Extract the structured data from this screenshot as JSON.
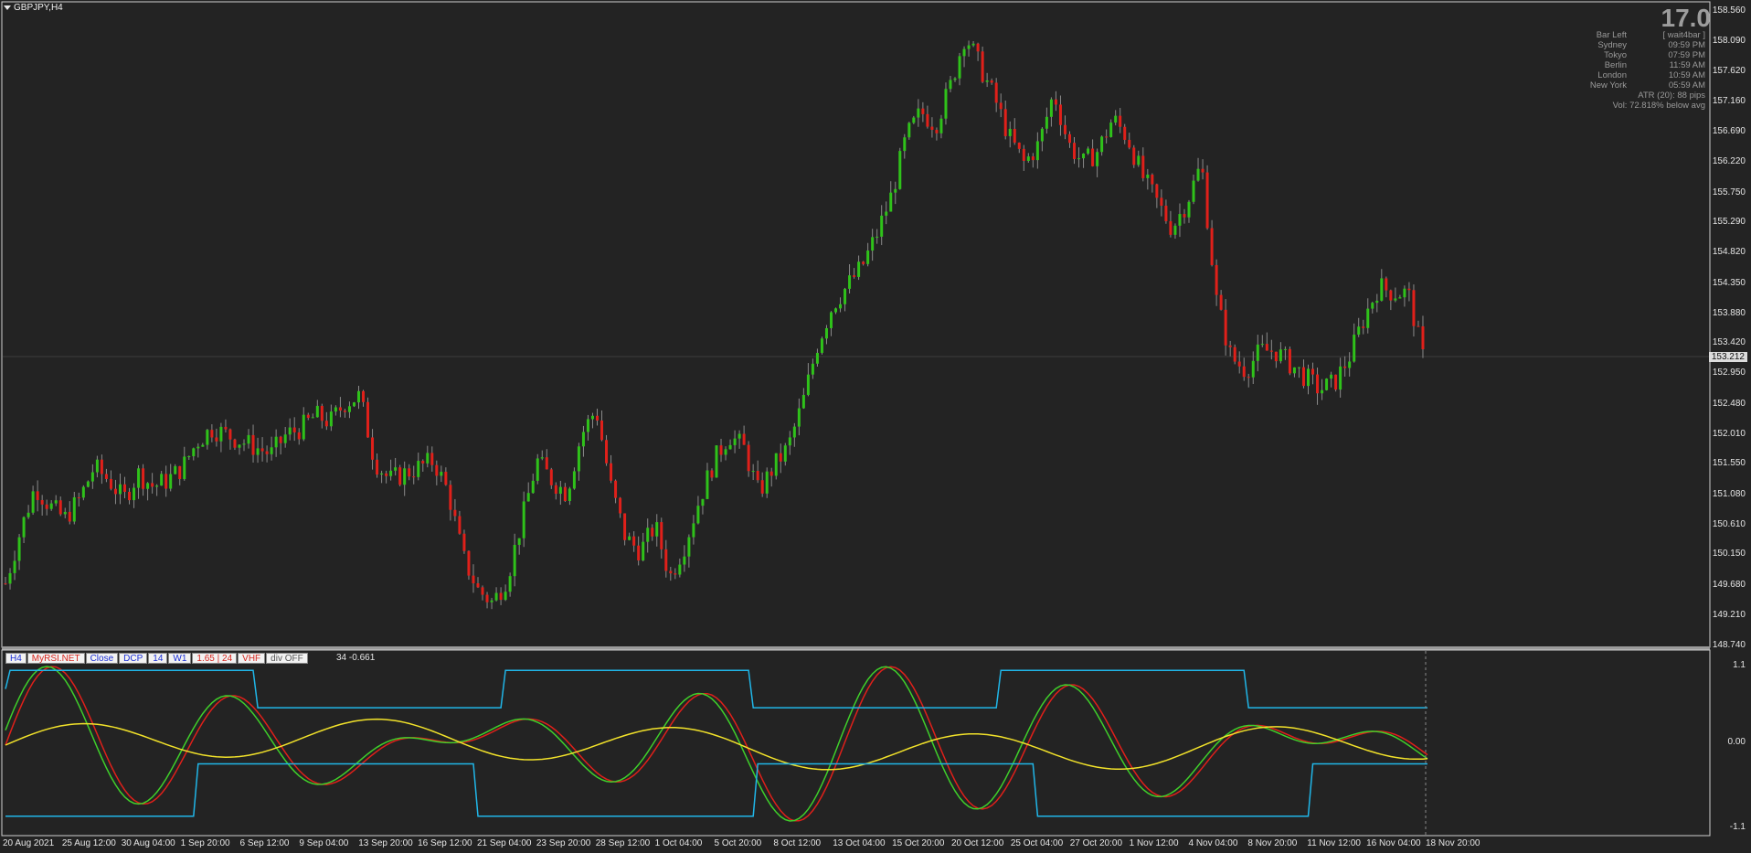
{
  "header": {
    "symbol": "GBPJPY,H4",
    "big_number": "17.0"
  },
  "info_panel": [
    {
      "label": "Bar Left",
      "value": "[ wait4bar ]"
    },
    {
      "label": "Sydney",
      "value": "09:59 PM"
    },
    {
      "label": "Tokyo",
      "value": "07:59 PM"
    },
    {
      "label": "Berlin",
      "value": "11:59 AM"
    },
    {
      "label": "London",
      "value": "10:59 AM"
    },
    {
      "label": "New York",
      "value": "05:59 AM"
    }
  ],
  "atr_text": "ATR (20): 88 pips",
  "vol_text": "Vol:  72.818% below avg",
  "current_price": "153.212",
  "price_axis": [
    "158.560",
    "158.090",
    "157.620",
    "157.160",
    "156.690",
    "156.220",
    "155.750",
    "155.290",
    "154.820",
    "154.350",
    "153.880",
    "153.420",
    "152.950",
    "152.480",
    "152.010",
    "151.550",
    "151.080",
    "150.610",
    "150.150",
    "149.680",
    "149.210",
    "148.740"
  ],
  "indicator_axis": [
    "1.1",
    "0.00",
    "-1.1"
  ],
  "time_axis": [
    "20 Aug 2021",
    "25 Aug 12:00",
    "30 Aug 04:00",
    "1 Sep 20:00",
    "6 Sep 12:00",
    "9 Sep 04:00",
    "13 Sep 20:00",
    "16 Sep 12:00",
    "21 Sep 04:00",
    "23 Sep 20:00",
    "28 Sep 12:00",
    "1 Oct 04:00",
    "5 Oct 20:00",
    "8 Oct 12:00",
    "13 Oct 04:00",
    "15 Oct 20:00",
    "20 Oct 12:00",
    "25 Oct 04:00",
    "27 Oct 20:00",
    "1 Nov 12:00",
    "4 Nov 04:00",
    "8 Nov 20:00",
    "11 Nov 12:00",
    "16 Nov 04:00",
    "18 Nov 20:00"
  ],
  "indicator_buttons": [
    {
      "label": "H4",
      "color": "blue"
    },
    {
      "label": "MyRSI.NET",
      "color": "red"
    },
    {
      "label": "Close",
      "color": "blue"
    },
    {
      "label": "DCP",
      "color": "blue"
    },
    {
      "label": "14",
      "color": "blue"
    },
    {
      "label": "W1",
      "color": "blue"
    },
    {
      "label": "1.65 | 24",
      "color": "red"
    },
    {
      "label": "VHF",
      "color": "red"
    },
    {
      "label": "div OFF",
      "color": "gray"
    }
  ],
  "indicator_value_text": "34 -0.661",
  "colors": {
    "background": "#232323",
    "bull": "#2fc21a",
    "bear": "#e0201a",
    "rsi_red": "#e0201a",
    "rsi_green": "#3fcf2a",
    "signal_yellow": "#f2e22a",
    "band_cyan": "#20b6e8",
    "grid": "#3a3a3a"
  },
  "chart_data": {
    "type": "candlestick",
    "symbol": "GBPJPY",
    "timeframe": "H4",
    "ylim": [
      148.74,
      158.56
    ],
    "close_path": [
      149.7,
      150.5,
      151.2,
      150.9,
      150.7,
      151.0,
      151.5,
      151.3,
      151.0,
      151.4,
      151.2,
      151.3,
      151.5,
      151.9,
      152.1,
      152.0,
      151.9,
      151.8,
      151.7,
      152.0,
      152.1,
      152.3,
      152.2,
      152.5,
      152.6,
      151.6,
      151.3,
      151.4,
      151.5,
      151.6,
      151.1,
      150.1,
      149.6,
      149.4,
      149.8,
      150.7,
      151.6,
      151.3,
      151.1,
      152.0,
      152.4,
      151.2,
      150.4,
      150.2,
      150.6,
      149.8,
      150.3,
      151.0,
      151.6,
      152.0,
      151.8,
      151.1,
      151.5,
      151.8,
      152.5,
      153.4,
      154.0,
      154.3,
      154.6,
      155.1,
      155.7,
      156.6,
      157.0,
      156.8,
      157.4,
      158.2,
      157.7,
      157.2,
      156.6,
      156.2,
      156.5,
      157.3,
      156.5,
      156.2,
      156.4,
      156.9,
      156.6,
      156.0,
      155.6,
      155.2,
      155.6,
      156.2,
      154.1,
      153.2,
      153.0,
      153.3,
      153.3,
      153.1,
      152.9,
      152.7,
      152.8,
      153.2,
      153.8,
      154.3,
      154.2,
      154.2,
      153.2
    ]
  }
}
